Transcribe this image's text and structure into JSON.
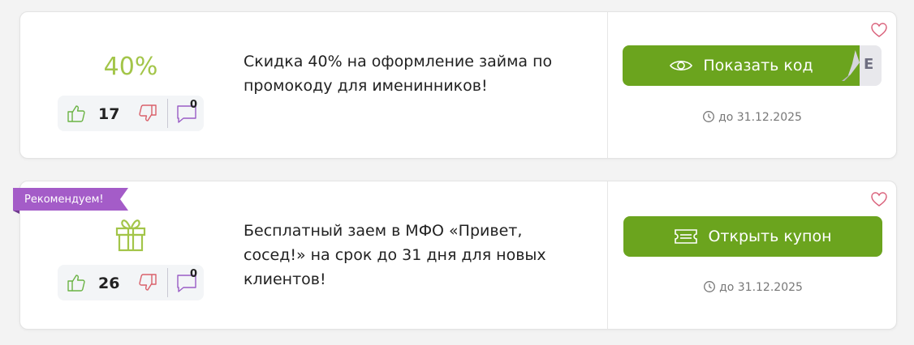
{
  "colors": {
    "accent_green": "#6ba41e",
    "discount_green": "#a3c549",
    "ribbon_purple": "#a45cc8",
    "vote_up": "#6bb344",
    "vote_down": "#d9606a",
    "comment": "#9a5cc6",
    "heart": "#d9607a"
  },
  "coupons": [
    {
      "badge": "40%",
      "votes": "17",
      "comments": "0",
      "description": "Скидка 40% на оформление займа по промокоду для именинников!",
      "button_label": "Показать код",
      "button_icon": "eye-icon",
      "code_peek": "E",
      "expiry": "до 31.12.2025"
    },
    {
      "ribbon": "Рекомендуем!",
      "badge_icon": "gift-icon",
      "votes": "26",
      "comments": "0",
      "description": "Бесплатный заем в МФО «Привет, сосед!» на срок до 31 дня для новых клиентов!",
      "button_label": "Открыть купон",
      "button_icon": "ticket-icon",
      "expiry": "до 31.12.2025"
    }
  ]
}
